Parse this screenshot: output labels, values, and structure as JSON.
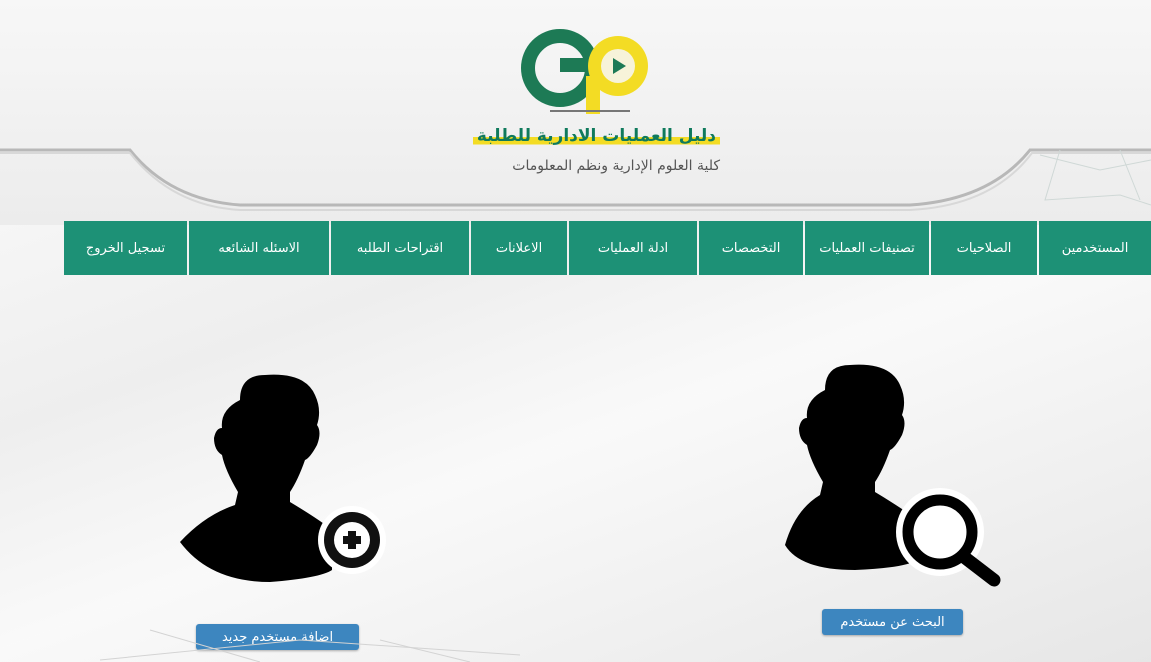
{
  "header": {
    "title": "دليل العمليات الادارية للطلبة",
    "subtitle": "كلية العلوم الإدارية ونظم المعلومات",
    "colors": {
      "brand_green": "#1d9176",
      "brand_yellow": "#f3dc24",
      "button_blue": "#3d86bf"
    }
  },
  "nav": {
    "items": [
      {
        "label": "المستخدمين"
      },
      {
        "label": "الصلاحيات"
      },
      {
        "label": "تصنيفات العمليات"
      },
      {
        "label": "التخصصات"
      },
      {
        "label": "ادلة العمليات"
      },
      {
        "label": "الاعلانات"
      },
      {
        "label": "اقتراحات الطلبه"
      },
      {
        "label": "الاسئله الشائعه"
      },
      {
        "label": "تسجيل الخروج"
      }
    ]
  },
  "actions": {
    "add_user": {
      "label": "اضافة مستخدم جديد",
      "icon": "user-add-icon"
    },
    "search_user": {
      "label": "البحث عن مستخدم",
      "icon": "user-search-icon"
    }
  }
}
